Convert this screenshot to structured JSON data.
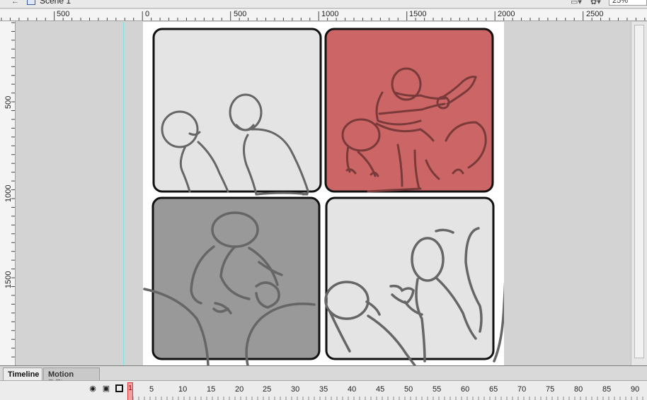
{
  "app": {
    "scene_label": "Scene 1",
    "zoom_value": "25%"
  },
  "ruler": {
    "horizontal_labels": [
      "500",
      "0",
      "500",
      "1000",
      "1500",
      "2000",
      "2500"
    ],
    "vertical_labels": [
      "500",
      "1000",
      "1500"
    ]
  },
  "stage": {
    "panels": [
      {
        "position": "top-left",
        "fill": "#e4e4e4"
      },
      {
        "position": "top-right",
        "fill": "#cc6666"
      },
      {
        "position": "bottom-left",
        "fill": "#999999"
      },
      {
        "position": "bottom-right",
        "fill": "#e4e4e4"
      }
    ]
  },
  "timeline": {
    "tabs": [
      "Timeline",
      "Motion Editor"
    ],
    "current_frame": "1",
    "frame_numbers": [
      "5",
      "10",
      "15",
      "20",
      "25",
      "30",
      "35",
      "40",
      "45",
      "50",
      "55",
      "60",
      "65",
      "70",
      "75",
      "80",
      "85",
      "90"
    ]
  }
}
